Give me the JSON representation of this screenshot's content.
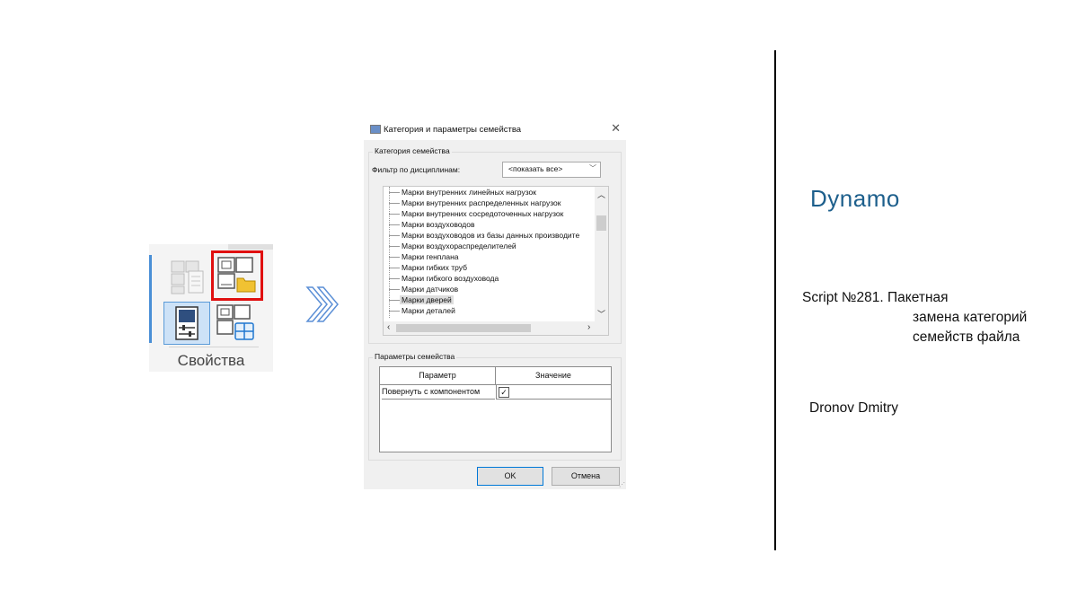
{
  "ribbon": {
    "panel_label": "Свойства"
  },
  "dialog": {
    "title": "Категория и параметры семейства",
    "close_glyph": "✕",
    "category_group_label": "Категория семейства",
    "filter_label": "Фильтр по дисциплинам:",
    "filter_value": "<показать все>",
    "categories": [
      "Марки внутренних линейных нагрузок",
      "Марки внутренних распределенных нагрузок",
      "Марки внутренних сосредоточенных нагрузок",
      "Марки воздуховодов",
      "Марки воздуховодов из базы данных производите",
      "Марки воздухораспределителей",
      "Марки генплана",
      "Марки гибких труб",
      "Марки гибкого воздуховода",
      "Марки датчиков",
      "Марки дверей",
      "Марки деталей"
    ],
    "selected_category": "Марки дверей",
    "params_group_label": "Параметры семейства",
    "param_header": "Параметр",
    "value_header": "Значение",
    "param_row_name": "Повернуть с компонентом",
    "param_row_checked": true,
    "ok_label": "OK",
    "cancel_label": "Отмена"
  },
  "right": {
    "app_name": "Dynamo",
    "script_line1": "Script №281. Пакетная",
    "script_line2": "замена категорий",
    "script_line3": "семейств файла",
    "author": "Dronov Dmitry"
  },
  "colors": {
    "dynamo_blue": "#1d5f8c",
    "highlight_red": "#e01010",
    "selected_blue": "#cde2f7"
  }
}
